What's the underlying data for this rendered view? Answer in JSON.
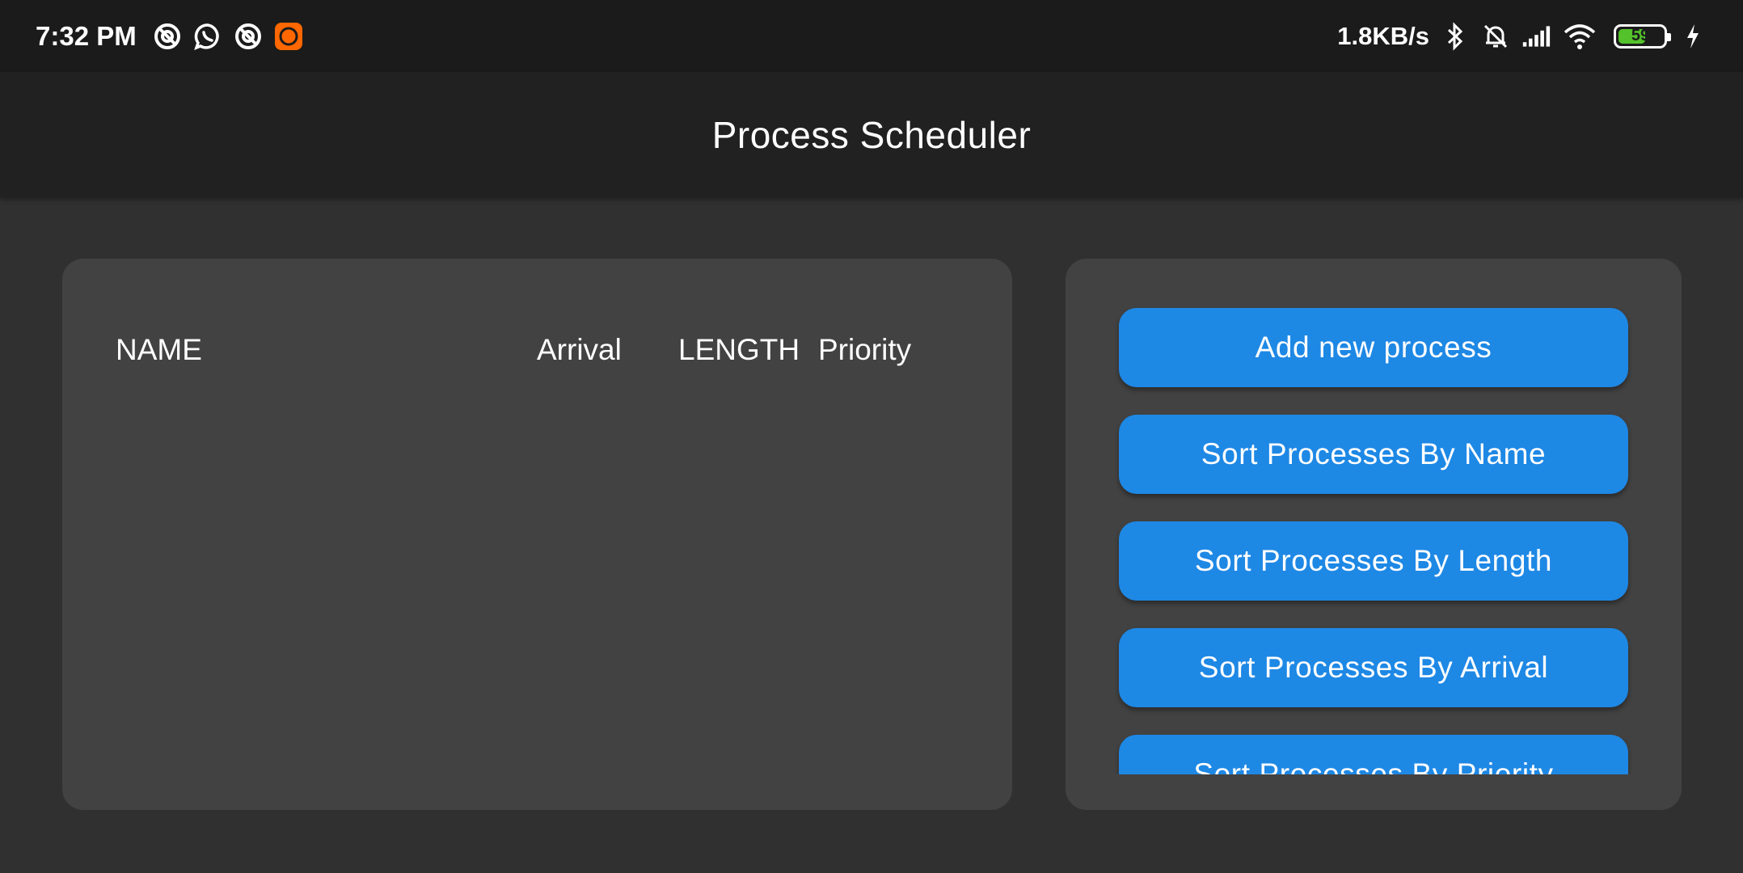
{
  "status_bar": {
    "time": "7:32 PM",
    "left_icons": [
      "pocket-casts-icon",
      "whatsapp-icon",
      "pocket-casts-icon",
      "mi-app-icon"
    ],
    "network_speed": "1.8KB/s",
    "right_icons": [
      "bluetooth-icon",
      "notifications-muted-icon",
      "cellular-signal-icon",
      "wifi-icon",
      "battery-icon",
      "charging-icon"
    ],
    "battery_level": "59",
    "mi_icon_color": "#ff6700",
    "battery_fill_color": "#53c22b"
  },
  "app_bar": {
    "title": "Process Scheduler"
  },
  "table": {
    "columns": [
      "NAME",
      "Arrival",
      "LENGTH",
      "Priority"
    ],
    "rows": []
  },
  "actions": {
    "button_color": "#1e88e5",
    "buttons": [
      "Add new process",
      "Sort Processes By Name",
      "Sort Processes By Length",
      "Sort Processes By Arrival",
      "Sort Processes By Priority"
    ]
  }
}
